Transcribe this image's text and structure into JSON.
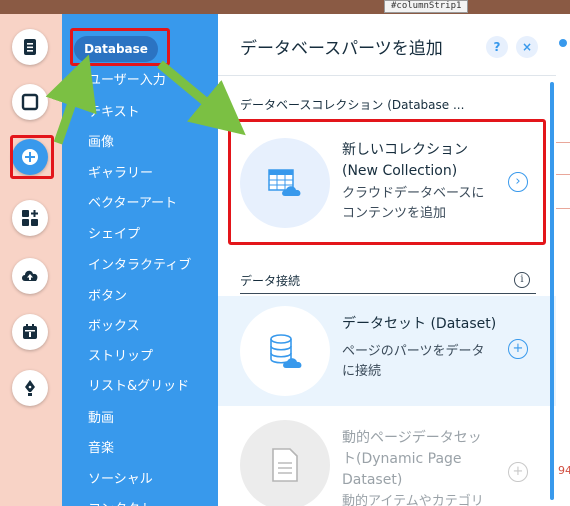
{
  "canvas": {
    "strip_label": "#columnStrip1",
    "right_text_1": "94"
  },
  "rail": {
    "items": [
      {
        "icon": "pages-icon"
      },
      {
        "icon": "background-icon"
      },
      {
        "icon": "add-icon",
        "active": true
      },
      {
        "icon": "app-market-icon"
      },
      {
        "icon": "upload-icon"
      },
      {
        "icon": "bookings-icon"
      },
      {
        "icon": "blog-pen-icon"
      }
    ]
  },
  "categories": {
    "selected": "Database",
    "items": [
      "ユーザー入力",
      "テキスト",
      "画像",
      "ギャラリー",
      "ベクターアート",
      "シェイプ",
      "インタラクティブ",
      "ボタン",
      "ボックス",
      "ストリップ",
      "リスト&グリッド",
      "動画",
      "音楽",
      "ソーシャル",
      "コンタクト"
    ]
  },
  "panel": {
    "title": "データベースパーツを追加",
    "help": "?",
    "close": "×",
    "section1": "データベースコレクション (Database ...",
    "section2": "データ接続",
    "info": "i",
    "items": [
      {
        "title_1": "新しいコレクション",
        "title_2": "(New Collection)",
        "desc_1": "クラウドデータベースに",
        "desc_2": "コンテンツを追加",
        "arrow": "›"
      },
      {
        "title_1": "データセット (Dataset)",
        "desc_1": "ページのパーツをデータ",
        "desc_2": "に接続",
        "arrow": "+"
      },
      {
        "title_1": "動的ページデータセッ",
        "title_2": "ト(Dynamic Page",
        "title_3": "Dataset)",
        "desc_1": "動的アイテムやカテゴリ",
        "arrow": "+"
      }
    ]
  },
  "colors": {
    "accent": "#3899ec",
    "highlight_red": "#e3151a",
    "arrow_green": "#7bc043"
  }
}
